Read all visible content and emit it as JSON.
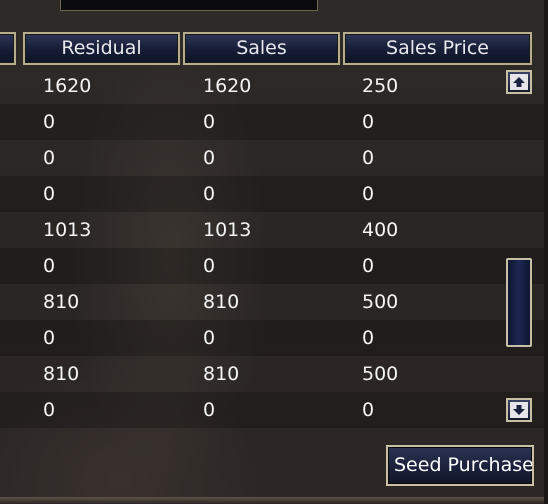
{
  "table": {
    "headers": [
      "Residual",
      "Sales",
      "Sales Price"
    ],
    "rows": [
      [
        "1620",
        "1620",
        "250"
      ],
      [
        "0",
        "0",
        "0"
      ],
      [
        "0",
        "0",
        "0"
      ],
      [
        "0",
        "0",
        "0"
      ],
      [
        "1013",
        "1013",
        "400"
      ],
      [
        "0",
        "0",
        "0"
      ],
      [
        "810",
        "810",
        "500"
      ],
      [
        "0",
        "0",
        "0"
      ],
      [
        "810",
        "810",
        "500"
      ],
      [
        "0",
        "0",
        "0"
      ]
    ]
  },
  "buttons": {
    "seed_purchase": "Seed Purchase"
  },
  "icons": {
    "scroll_up": "arrow-up-icon",
    "scroll_down": "arrow-down-icon"
  },
  "colors": {
    "header_bg": "#161d35",
    "header_border": "#b6ad8b",
    "text": "#f4f4f4"
  }
}
